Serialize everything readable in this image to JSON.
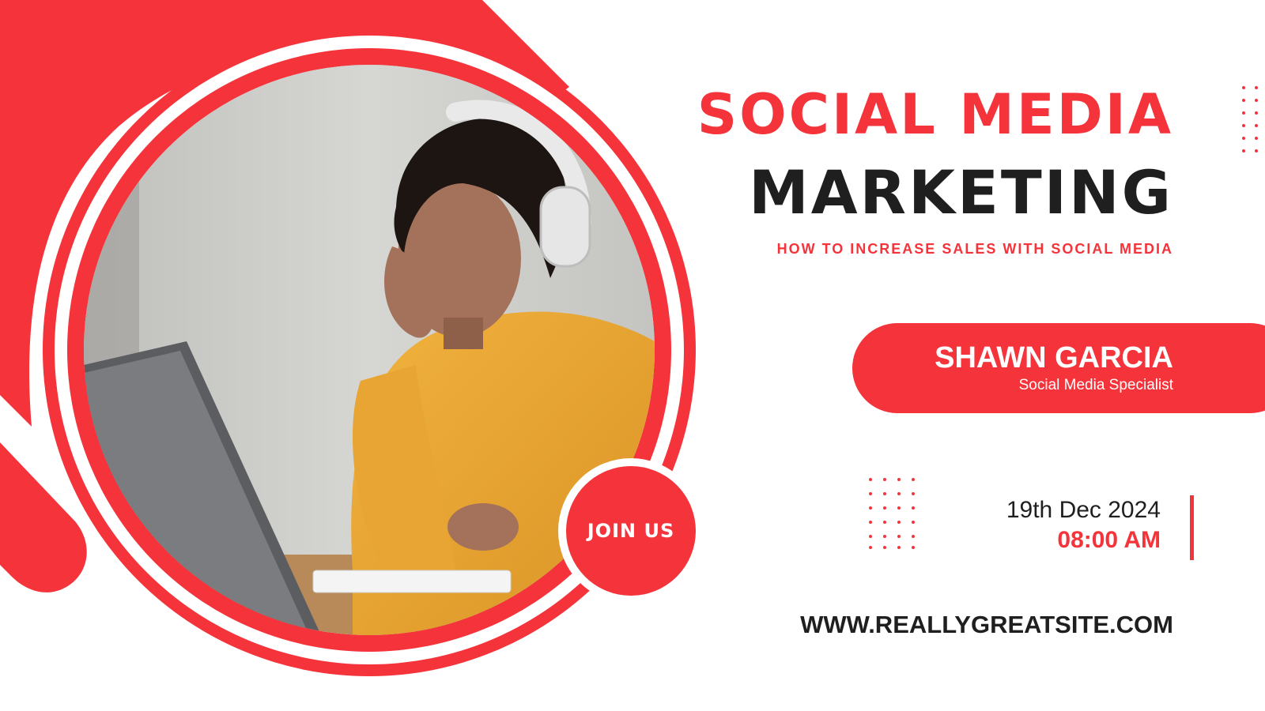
{
  "title": {
    "line1": "SOCIAL MEDIA",
    "line2": "MARKETING"
  },
  "subtitle": "HOW TO INCREASE SALES WITH SOCIAL MEDIA",
  "speaker": {
    "name": "SHAWN GARCIA",
    "role": "Social Media Specialist"
  },
  "event": {
    "date": "19th Dec 2024",
    "time": "08:00 AM"
  },
  "website": "WWW.REALLYGREATSITE.COM",
  "cta": {
    "label": "JOIN US"
  },
  "colors": {
    "accent": "#f5333a",
    "dark": "#1f1f1f",
    "background": "#ffffff"
  },
  "photo": {
    "description_icon": "person-with-headphones-at-laptop-photo"
  }
}
